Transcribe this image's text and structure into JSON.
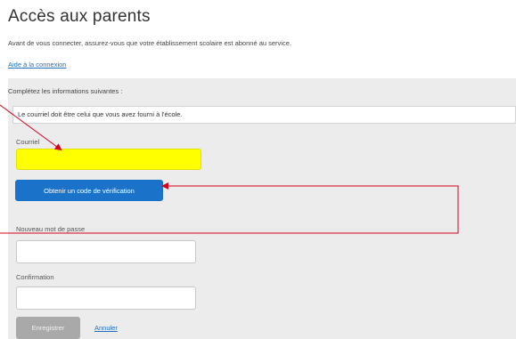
{
  "page": {
    "title": "Accès aux parents",
    "intro": "Avant de vous connecter, assurez-vous que votre établissement scolaire est abonné au service.",
    "help_link": "Aide à la connexion"
  },
  "form": {
    "heading": "Complétez les informations suivantes :",
    "notice": "Le courriel doit être celui que vous avez fourni à l'école.",
    "email_label": "Courriel",
    "email_value": "",
    "get_code_label": "Obtenir un code de vérification",
    "new_password_label": "Nouveau mot de passe",
    "confirmation_label": "Confirmation",
    "save_label": "Enregistrer",
    "cancel_label": "Annuler"
  },
  "annotations": {
    "highlight_color": "#ffff00",
    "arrow_color": "#d9001b"
  }
}
